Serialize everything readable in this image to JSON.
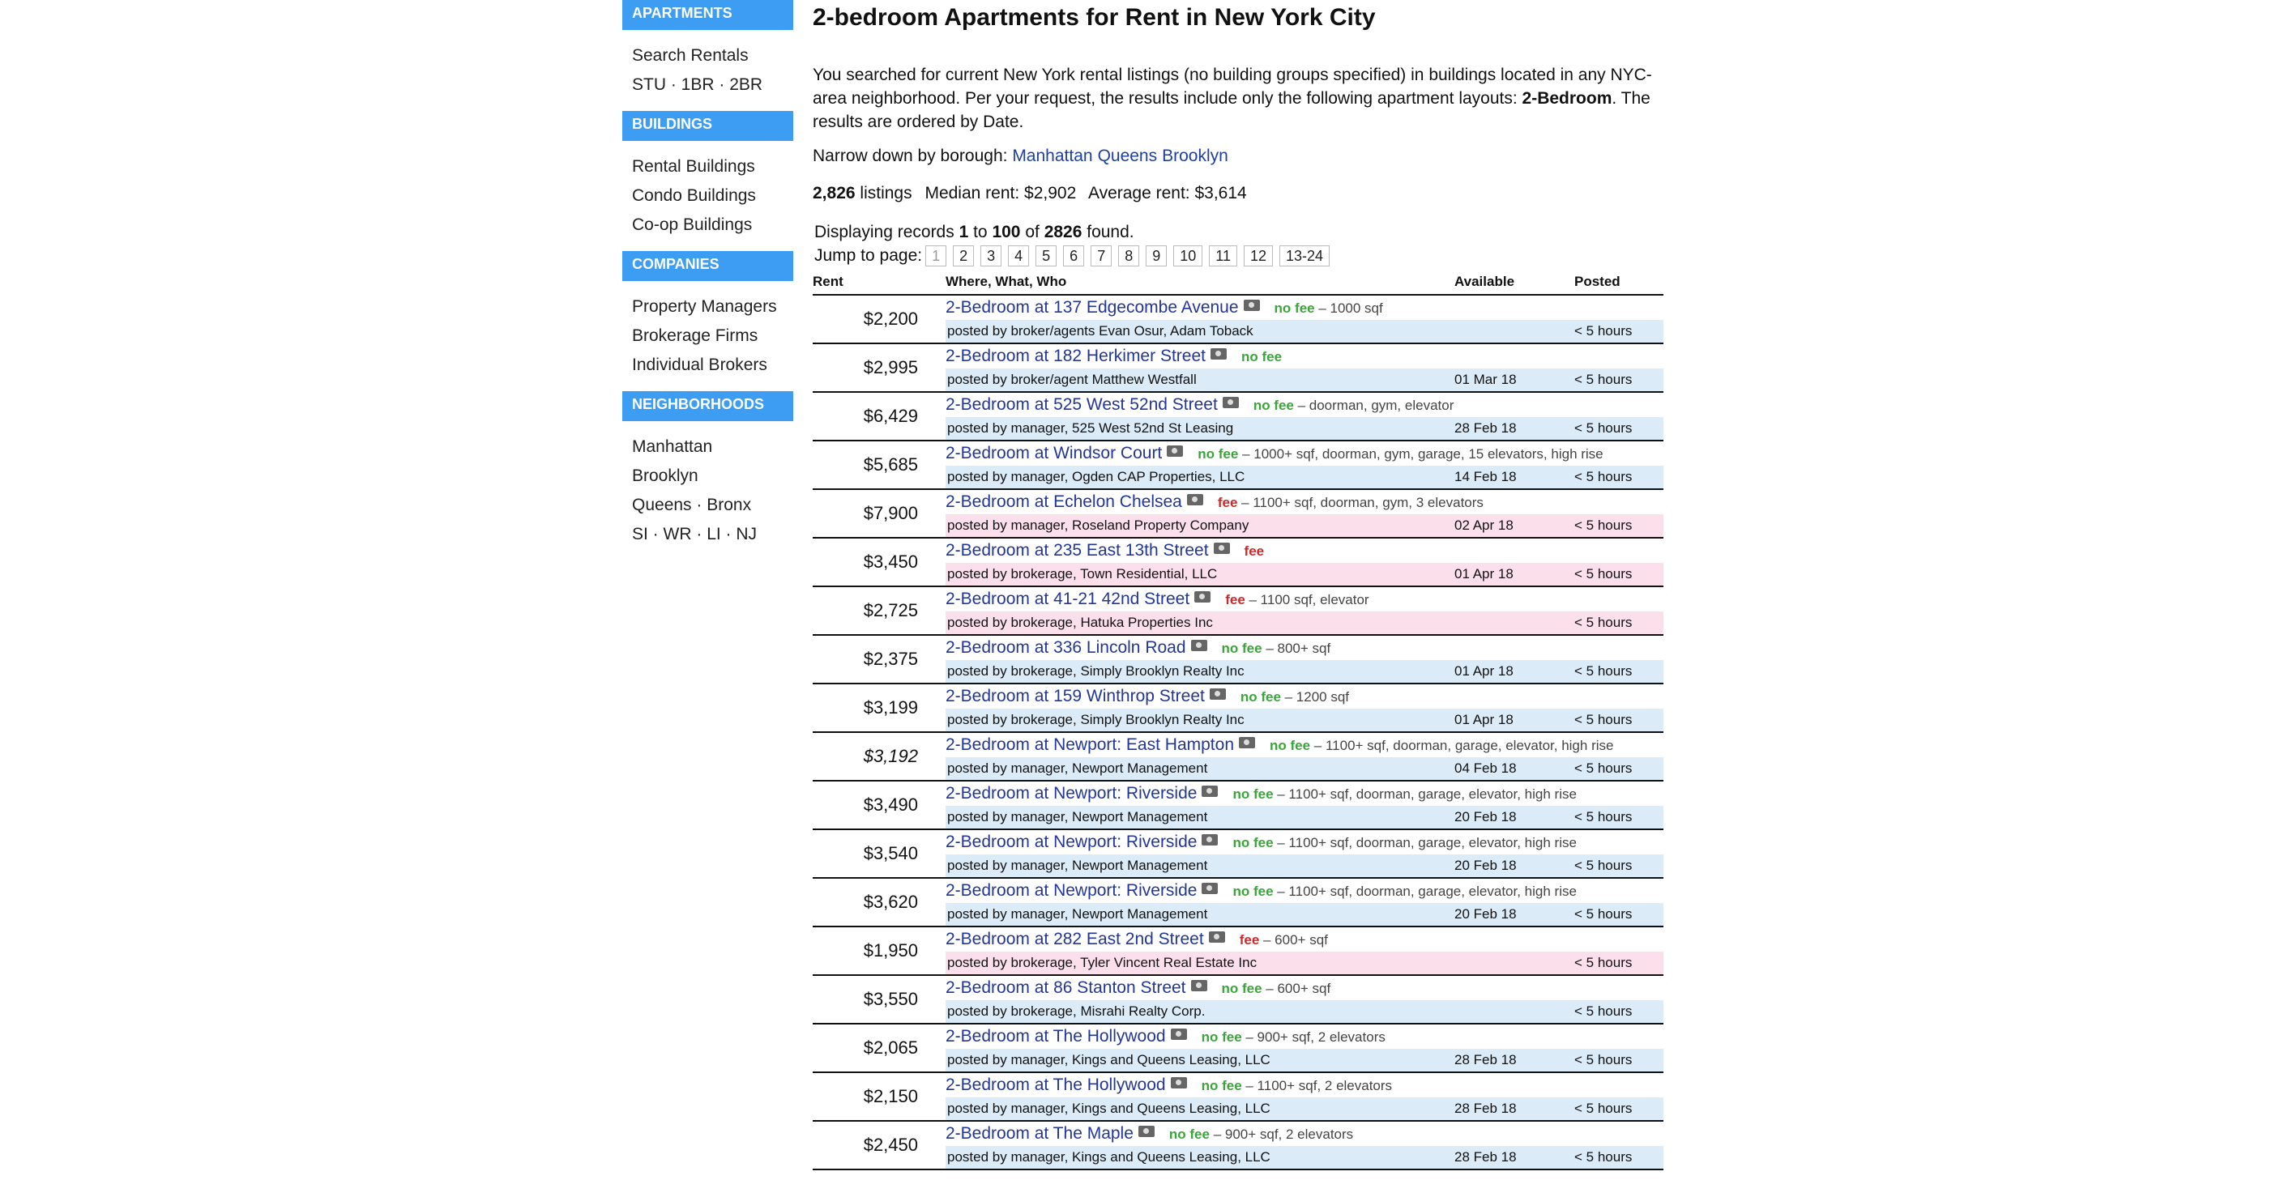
{
  "sidebar": {
    "sections": [
      {
        "title": "APARTMENTS",
        "items": [
          [
            "Search Rentals"
          ],
          [
            "STU",
            "1BR",
            "2BR"
          ]
        ]
      },
      {
        "title": "BUILDINGS",
        "items": [
          [
            "Rental Buildings"
          ],
          [
            "Condo Buildings"
          ],
          [
            "Co-op Buildings"
          ]
        ]
      },
      {
        "title": "COMPANIES",
        "items": [
          [
            "Property Managers"
          ],
          [
            "Brokerage Firms"
          ],
          [
            "Individual Brokers"
          ]
        ]
      },
      {
        "title": "NEIGHBORHOODS",
        "items": [
          [
            "Manhattan"
          ],
          [
            "Brooklyn"
          ],
          [
            "Queens",
            "Bronx"
          ],
          [
            "SI",
            "WR",
            "LI",
            "NJ"
          ]
        ]
      }
    ]
  },
  "main": {
    "title": "2-bedroom Apartments for Rent in New York City",
    "intro_pre": "You searched for current New York rental listings (no building groups specified) in buildings located in any NYC-area neighborhood. Per your request, the results include only the following apartment layouts: ",
    "intro_bold": "2-Bedroom",
    "intro_post": ". The results are ordered by Date.",
    "narrow_label": "Narrow down by borough:",
    "boroughs": [
      "Manhattan",
      "Queens",
      "Brooklyn"
    ],
    "stats": {
      "count": "2,826",
      "count_label": "listings",
      "median": "Median rent: $2,902",
      "average": "Average rent: $3,614"
    },
    "display": {
      "pre": "Displaying records ",
      "from": "1",
      "mid": " to ",
      "to": "100",
      "of": " of ",
      "total": "2826",
      "post": " found."
    },
    "jump_label": "Jump to page:",
    "pages": [
      "1",
      "2",
      "3",
      "4",
      "5",
      "6",
      "7",
      "8",
      "9",
      "10",
      "11",
      "12",
      "13-24"
    ],
    "columns": {
      "rent": "Rent",
      "where": "Where, What, Who",
      "available": "Available",
      "posted": "Posted"
    }
  },
  "listings": [
    {
      "rent": "$2,200",
      "title": "2-Bedroom at 137 Edgecombe Avenue",
      "fee": "no fee",
      "desc": " – 1000 sqf",
      "poster": "posted by broker/agents Evan Osur, Adam Toback",
      "available": "",
      "posted": "< 5 hours"
    },
    {
      "rent": "$2,995",
      "title": "2-Bedroom at 182 Herkimer Street",
      "fee": "no fee",
      "desc": "",
      "poster": "posted by broker/agent Matthew Westfall",
      "available": "01 Mar 18",
      "posted": "< 5 hours"
    },
    {
      "rent": "$6,429",
      "title": "2-Bedroom at 525 West 52nd Street",
      "fee": "no fee",
      "desc": " – doorman, gym, elevator",
      "poster": "posted by manager, 525 West 52nd St Leasing",
      "available": "28 Feb 18",
      "posted": "< 5 hours"
    },
    {
      "rent": "$5,685",
      "title": "2-Bedroom at Windsor Court",
      "fee": "no fee",
      "desc": " – 1000+ sqf, doorman, gym, garage, 15 elevators, high rise",
      "poster": "posted by manager, Ogden CAP Properties, LLC",
      "available": "14 Feb 18",
      "posted": "< 5 hours"
    },
    {
      "rent": "$7,900",
      "title": "2-Bedroom at Echelon Chelsea",
      "fee": "fee",
      "desc": " – 1100+ sqf, doorman, gym, 3 elevators",
      "poster": "posted by manager, Roseland Property Company",
      "available": "02 Apr 18",
      "posted": "< 5 hours"
    },
    {
      "rent": "$3,450",
      "title": "2-Bedroom at 235 East 13th Street",
      "fee": "fee",
      "desc": "",
      "poster": "posted by brokerage, Town Residential, LLC",
      "available": "01 Apr 18",
      "posted": "< 5 hours"
    },
    {
      "rent": "$2,725",
      "title": "2-Bedroom at 41-21 42nd Street",
      "fee": "fee",
      "desc": " – 1100 sqf, elevator",
      "poster": "posted by brokerage, Hatuka Properties Inc",
      "available": "",
      "posted": "< 5 hours"
    },
    {
      "rent": "$2,375",
      "title": "2-Bedroom at 336 Lincoln Road",
      "fee": "no fee",
      "desc": " – 800+ sqf",
      "poster": "posted by brokerage, Simply Brooklyn Realty Inc",
      "available": "01 Apr 18",
      "posted": "< 5 hours"
    },
    {
      "rent": "$3,199",
      "title": "2-Bedroom at 159 Winthrop Street",
      "fee": "no fee",
      "desc": " – 1200 sqf",
      "poster": "posted by brokerage, Simply Brooklyn Realty Inc",
      "available": "01 Apr 18",
      "posted": "< 5 hours"
    },
    {
      "rent": "$3,192",
      "italic": true,
      "title": "2-Bedroom at Newport: East Hampton",
      "fee": "no fee",
      "desc": " – 1100+ sqf, doorman, garage, elevator, high rise",
      "poster": "posted by manager, Newport Management",
      "available": "04 Feb 18",
      "posted": "< 5 hours"
    },
    {
      "rent": "$3,490",
      "title": "2-Bedroom at Newport: Riverside",
      "fee": "no fee",
      "desc": " – 1100+ sqf, doorman, garage, elevator, high rise",
      "poster": "posted by manager, Newport Management",
      "available": "20 Feb 18",
      "posted": "< 5 hours"
    },
    {
      "rent": "$3,540",
      "title": "2-Bedroom at Newport: Riverside",
      "fee": "no fee",
      "desc": " – 1100+ sqf, doorman, garage, elevator, high rise",
      "poster": "posted by manager, Newport Management",
      "available": "20 Feb 18",
      "posted": "< 5 hours"
    },
    {
      "rent": "$3,620",
      "title": "2-Bedroom at Newport: Riverside",
      "fee": "no fee",
      "desc": " – 1100+ sqf, doorman, garage, elevator, high rise",
      "poster": "posted by manager, Newport Management",
      "available": "20 Feb 18",
      "posted": "< 5 hours"
    },
    {
      "rent": "$1,950",
      "title": "2-Bedroom at 282 East 2nd Street",
      "fee": "fee",
      "desc": " – 600+ sqf",
      "poster": "posted by brokerage, Tyler Vincent Real Estate Inc",
      "available": "",
      "posted": "< 5 hours"
    },
    {
      "rent": "$3,550",
      "title": "2-Bedroom at 86 Stanton Street",
      "fee": "no fee",
      "desc": " – 600+ sqf",
      "poster": "posted by brokerage, Misrahi Realty Corp.",
      "available": "",
      "posted": "< 5 hours"
    },
    {
      "rent": "$2,065",
      "title": "2-Bedroom at The Hollywood",
      "fee": "no fee",
      "desc": " – 900+ sqf, 2 elevators",
      "poster": "posted by manager, Kings and Queens Leasing, LLC",
      "available": "28 Feb 18",
      "posted": "< 5 hours"
    },
    {
      "rent": "$2,150",
      "title": "2-Bedroom at The Hollywood",
      "fee": "no fee",
      "desc": " – 1100+ sqf, 2 elevators",
      "poster": "posted by manager, Kings and Queens Leasing, LLC",
      "available": "28 Feb 18",
      "posted": "< 5 hours"
    },
    {
      "rent": "$2,450",
      "title": "2-Bedroom at The Maple",
      "fee": "no fee",
      "desc": " – 900+ sqf, 2 elevators",
      "poster": "posted by manager, Kings and Queens Leasing, LLC",
      "available": "28 Feb 18",
      "posted": "< 5 hours"
    }
  ],
  "colors": {
    "accent": "#3d9df2",
    "link": "#22369a",
    "no_fee": "#3aa63a",
    "fee": "#d02828",
    "row_no_fee_bg": "#dcebf8",
    "row_fee_bg": "#fbe0ec"
  }
}
